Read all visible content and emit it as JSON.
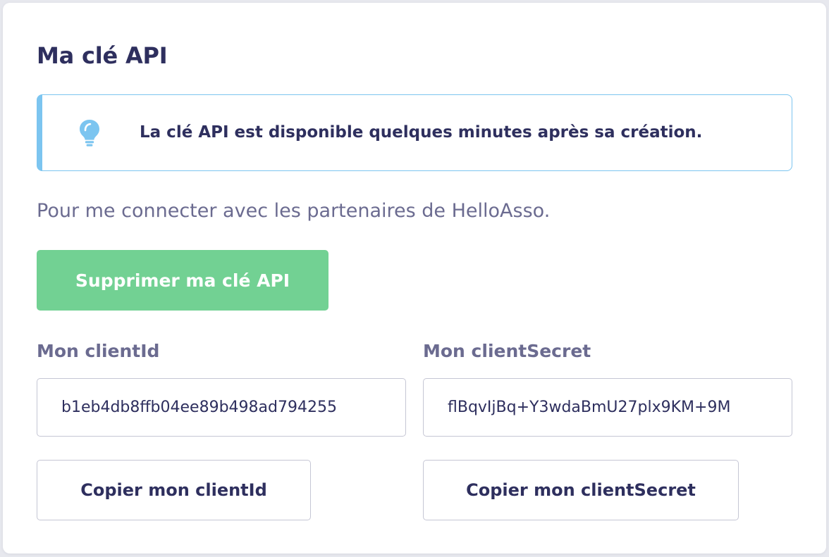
{
  "api_key_section": {
    "title": "Ma clé API",
    "info_banner": {
      "icon": "lightbulb-icon",
      "message": "La clé API est disponible quelques minutes après sa création.",
      "accent_color": "#7cc5f0"
    },
    "description": "Pour me connecter avec les partenaires de HelloAsso.",
    "delete_button_label": "Supprimer ma clé API",
    "delete_button_color": "#72d193",
    "client_id": {
      "label": "Mon clientId",
      "value": "b1eb4db8ffb04ee89b498ad794255",
      "copy_button_label": "Copier mon clientId"
    },
    "client_secret": {
      "label": "Mon clientSecret",
      "value": "flBqvIjBq+Y3wdaBmU27plx9KM+9M",
      "copy_button_label": "Copier mon clientSecret"
    }
  }
}
